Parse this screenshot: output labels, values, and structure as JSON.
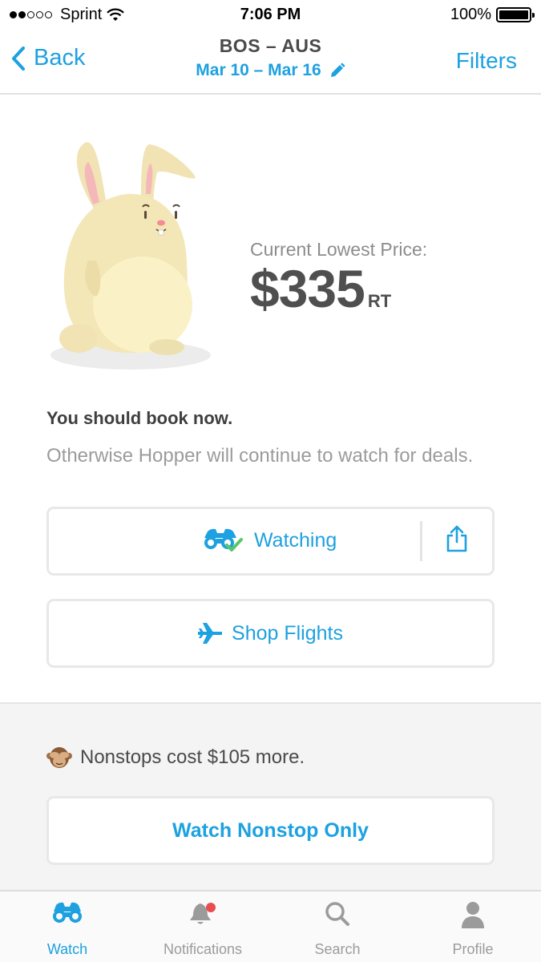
{
  "status_bar": {
    "carrier": "Sprint",
    "time": "7:06 PM",
    "battery": "100%"
  },
  "nav": {
    "back_label": "Back",
    "title": "BOS – AUS",
    "dates": "Mar 10 – Mar 16",
    "filters_label": "Filters"
  },
  "price": {
    "label": "Current Lowest Price:",
    "value": "$335",
    "unit": "RT"
  },
  "advice": {
    "title": "You should book now.",
    "body": "Otherwise Hopper will continue to watch for deals."
  },
  "actions": {
    "watching_label": "Watching",
    "shop_label": "Shop Flights"
  },
  "nonstop": {
    "message": "Nonstops cost $105 more.",
    "button_label": "Watch Nonstop Only"
  },
  "tabs": [
    {
      "label": "Watch",
      "icon": "binoculars-icon",
      "active": true
    },
    {
      "label": "Notifications",
      "icon": "bell-icon",
      "active": false
    },
    {
      "label": "Search",
      "icon": "search-icon",
      "active": false
    },
    {
      "label": "Profile",
      "icon": "person-icon",
      "active": false
    }
  ],
  "colors": {
    "accent": "#1da1e0",
    "text_dark": "#4a4a4a",
    "text_muted": "#9b9b9b",
    "check_green": "#5cc66b",
    "notification_dot": "#e94e4e"
  }
}
